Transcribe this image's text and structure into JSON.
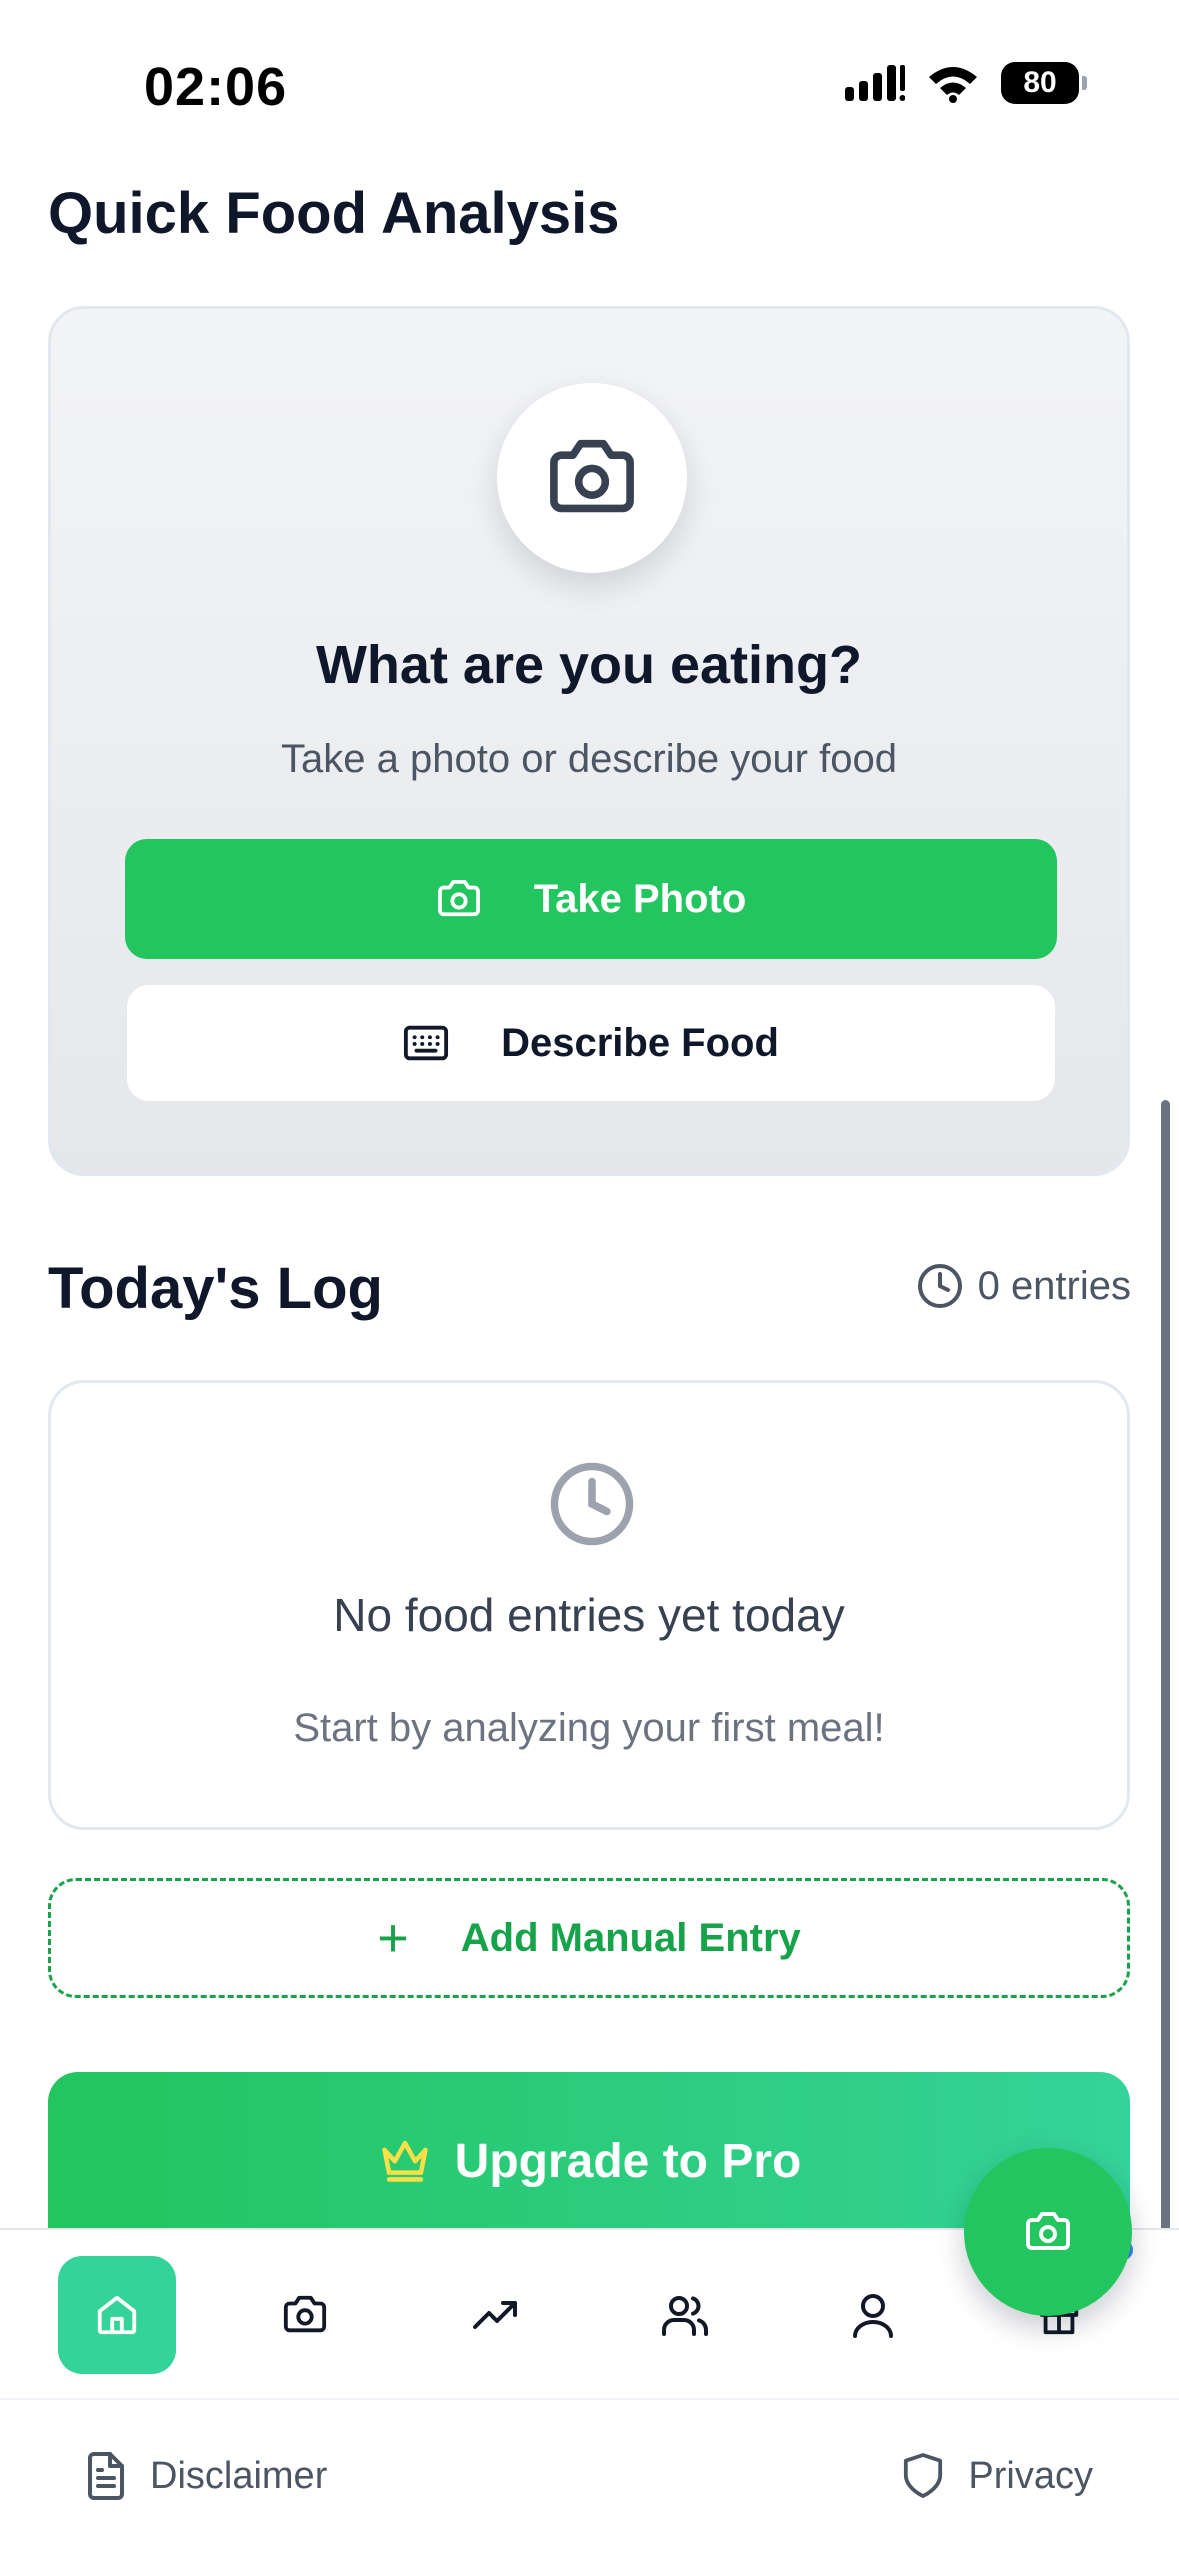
{
  "status_bar": {
    "time": "02:06",
    "battery": "80",
    "icons": [
      "signal-icon",
      "wifi-icon",
      "battery-icon"
    ]
  },
  "quick_analysis": {
    "title": "Quick Food Analysis",
    "heading": "What are you eating?",
    "subtitle": "Take a photo or describe your food",
    "take_photo_label": "Take Photo",
    "describe_food_label": "Describe Food"
  },
  "todays_log": {
    "title": "Today's Log",
    "entries_count": "0 entries",
    "empty_title": "No food entries yet today",
    "empty_subtitle": "Start by analyzing your first meal!",
    "add_manual_label": "Add Manual Entry"
  },
  "upgrade": {
    "label": "Upgrade to Pro"
  },
  "bottom_nav": {
    "items": [
      "home-icon",
      "camera-icon",
      "trending-icon",
      "users-icon",
      "user-icon",
      "gift-icon"
    ],
    "active": "home-icon"
  },
  "footer": {
    "disclaimer": "Disclaimer",
    "privacy": "Privacy"
  },
  "colors": {
    "primary": "#22c55e",
    "active_nav": "#34d399",
    "text_dark": "#0f172a",
    "text_muted": "#4b5563"
  }
}
